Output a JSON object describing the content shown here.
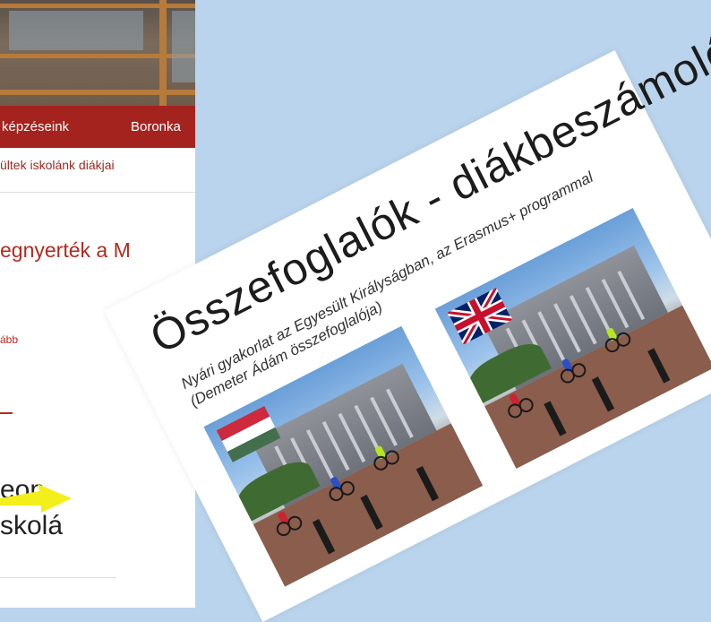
{
  "site": {
    "nav_items": [
      "képzéseink",
      "Boronka"
    ],
    "breadcrumb": "ültek iskolánk diákjai",
    "headline": "egnyerték a M",
    "more_link": "ább",
    "big_line1": "eon",
    "big_line2": "skolá"
  },
  "card": {
    "title": "Összefoglalók - diákbeszámolók",
    "subtitle_line1": "Nyári gyakorlat az Egyesült Királyságban, az Erasmus+ programmal",
    "subtitle_line2": "(Demeter Ádám összefoglalója)",
    "flags": [
      "hungary-flag",
      "uk-flag"
    ]
  },
  "colors": {
    "background": "#b9d4ec",
    "nav_red": "#a5231e",
    "link_red": "#b32a20",
    "arrow_yellow": "#f2ef1b"
  }
}
